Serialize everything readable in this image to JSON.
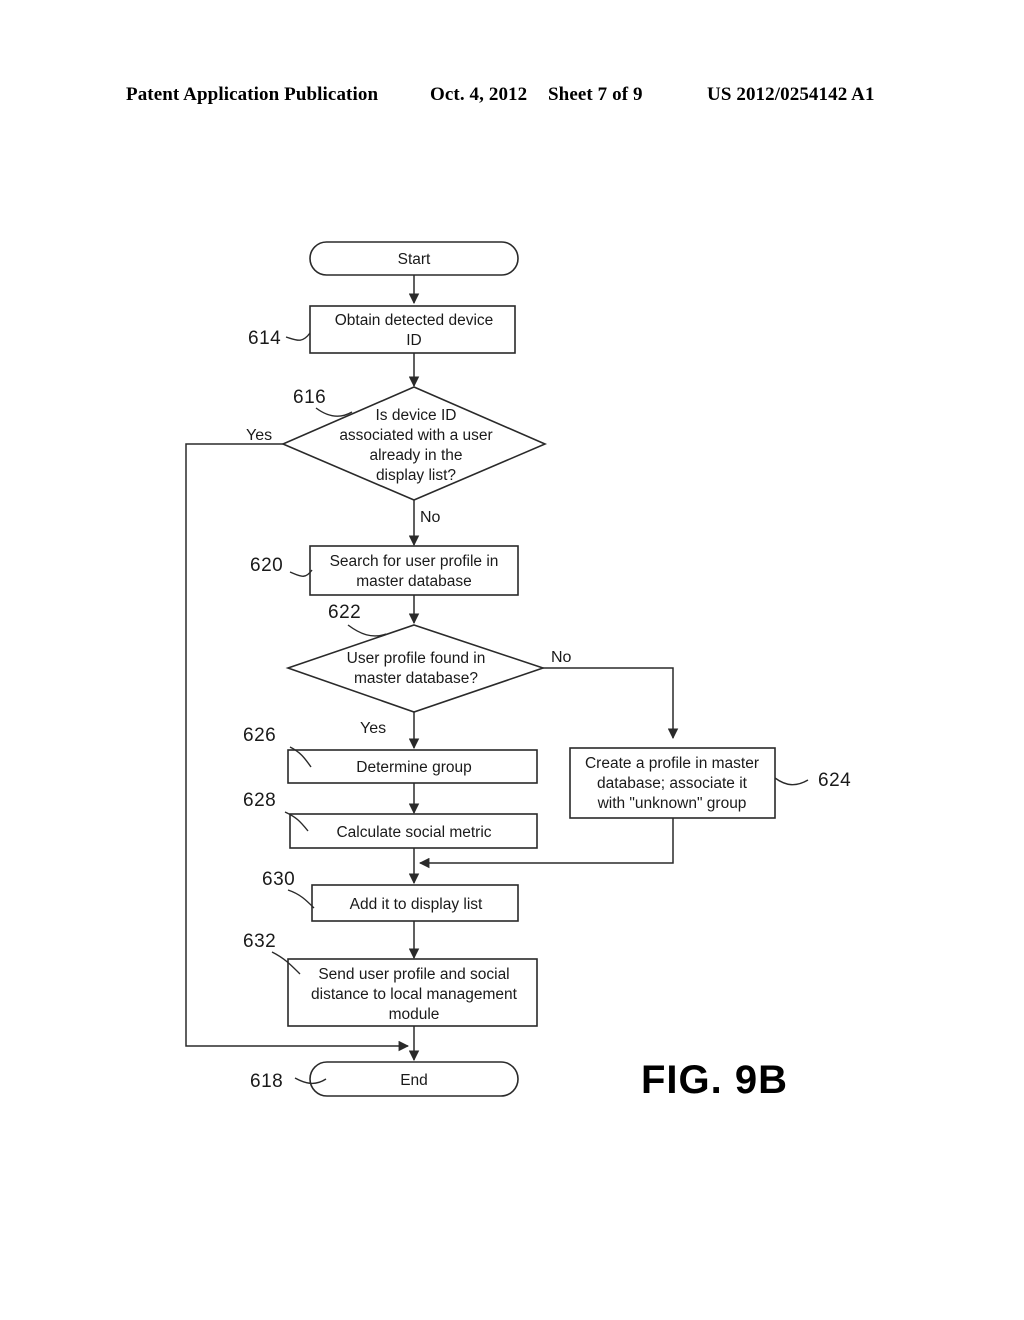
{
  "header": {
    "publication": "Patent Application Publication",
    "date": "Oct. 4, 2012",
    "sheet": "Sheet 7 of 9",
    "patent_number": "US 2012/0254142 A1"
  },
  "figure": {
    "label": "FIG. 9B"
  },
  "flowchart": {
    "nodes": {
      "start": {
        "ref": "",
        "label": "Start",
        "type": "terminal"
      },
      "n614": {
        "ref": "614",
        "label": "Obtain detected device ID",
        "type": "process"
      },
      "n616": {
        "ref": "616",
        "label": "Is device ID associated with a user already in the display list?",
        "type": "decision"
      },
      "n620": {
        "ref": "620",
        "label": "Search for user profile in master database",
        "type": "process"
      },
      "n622": {
        "ref": "622",
        "label": "User profile found in master database?",
        "type": "decision"
      },
      "n624": {
        "ref": "624",
        "label": "Create a profile in master database; associate it with \"unknown\" group",
        "type": "process"
      },
      "n626": {
        "ref": "626",
        "label": "Determine group",
        "type": "process"
      },
      "n628": {
        "ref": "628",
        "label": "Calculate social metric",
        "type": "process"
      },
      "n630": {
        "ref": "630",
        "label": "Add it to display list",
        "type": "process"
      },
      "n632": {
        "ref": "632",
        "label": "Send user profile and social distance to local management module",
        "type": "process"
      },
      "end": {
        "ref": "618",
        "label": "End",
        "type": "terminal"
      }
    },
    "node_text_lines": {
      "start": [
        "Start"
      ],
      "n614": [
        "Obtain detected device",
        "ID"
      ],
      "n616": [
        "Is device ID",
        "associated with a user",
        "already in the",
        "display list?"
      ],
      "n620": [
        "Search for user profile in",
        "master database"
      ],
      "n622": [
        "User profile found in",
        "master database?"
      ],
      "n624": [
        "Create a profile in master",
        "database; associate it",
        "with \"unknown\" group"
      ],
      "n626": [
        "Determine group"
      ],
      "n628": [
        "Calculate social metric"
      ],
      "n630": [
        "Add it to display list"
      ],
      "n632": [
        "Send user profile and social",
        "distance to local management",
        "module"
      ],
      "end": [
        "End"
      ]
    },
    "edge_labels": {
      "e616_yes": "Yes",
      "e616_no": "No",
      "e622_no": "No",
      "e622_yes": "Yes"
    },
    "ref_labels": {
      "r614": "614",
      "r616": "616",
      "r620": "620",
      "r622": "622",
      "r624": "624",
      "r626": "626",
      "r628": "628",
      "r630": "630",
      "r632": "632",
      "r618": "618"
    }
  },
  "colors": {
    "ink": "#2a2a2a",
    "text": "#1a1a1a",
    "paper": "#ffffff"
  }
}
